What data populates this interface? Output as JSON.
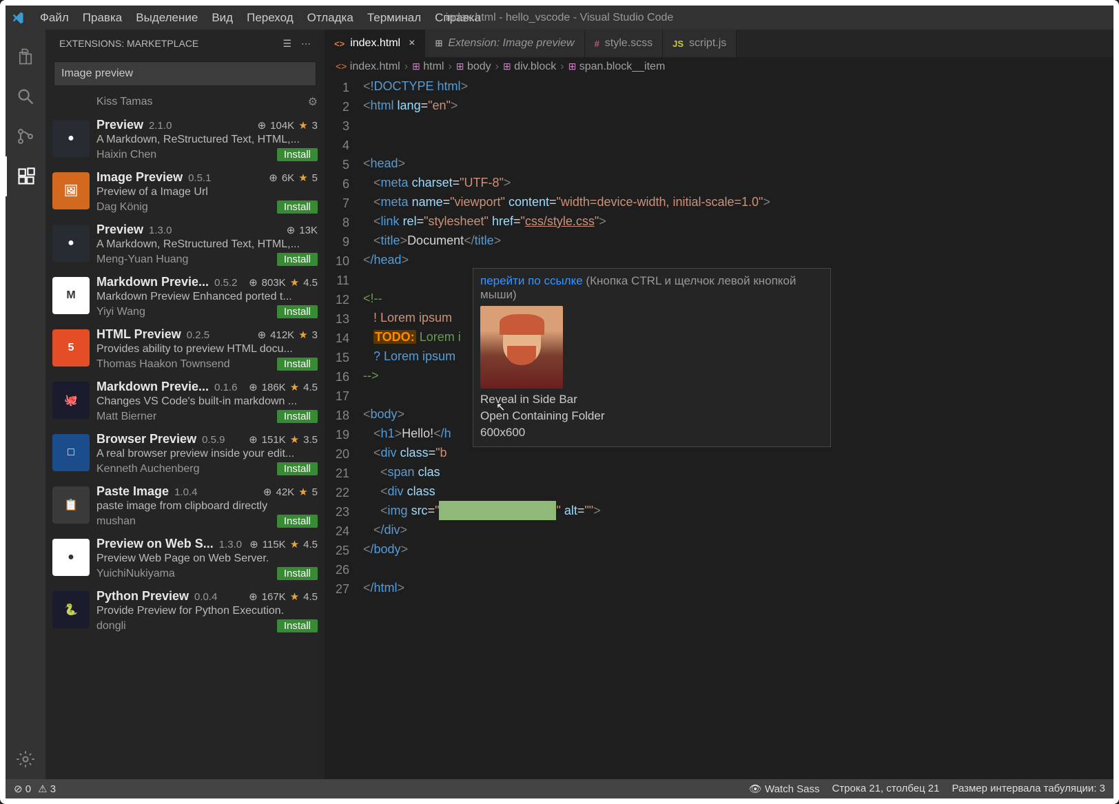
{
  "titlebar": {
    "menus": [
      "Файл",
      "Правка",
      "Выделение",
      "Вид",
      "Переход",
      "Отладка",
      "Терминал",
      "Справка"
    ],
    "title": "index.html - hello_vscode - Visual Studio Code"
  },
  "sidebar": {
    "header": "EXTENSIONS: MARKETPLACE",
    "search": "Image preview"
  },
  "extensions": [
    {
      "partial": true,
      "name": "",
      "version": "",
      "downloads": "",
      "rating": "",
      "desc": "",
      "author": "Kiss Tamas",
      "install": "",
      "iconBg": "",
      "iconText": ""
    },
    {
      "name": "Preview",
      "version": "2.1.0",
      "downloads": "104K",
      "rating": "3",
      "desc": "A Markdown, ReStructured Text, HTML,...",
      "author": "Haixin Chen",
      "install": "Install",
      "iconBg": "#272c33",
      "iconText": "●"
    },
    {
      "name": "Image Preview",
      "version": "0.5.1",
      "downloads": "6K",
      "rating": "5",
      "desc": "Preview of a Image Url",
      "author": "Dag König",
      "install": "Install",
      "iconBg": "#d2691e",
      "iconText": "🖼"
    },
    {
      "name": "Preview",
      "version": "1.3.0",
      "downloads": "13K",
      "rating": "",
      "desc": "A Markdown, ReStructured Text, HTML,...",
      "author": "Meng-Yuan Huang",
      "install": "Install",
      "iconBg": "#272c33",
      "iconText": "●"
    },
    {
      "name": "Markdown Previe...",
      "version": "0.5.2",
      "downloads": "803K",
      "rating": "4.5",
      "desc": "Markdown Preview Enhanced ported t...",
      "author": "Yiyi Wang",
      "install": "Install",
      "iconBg": "#fff",
      "iconText": "M"
    },
    {
      "name": "HTML Preview",
      "version": "0.2.5",
      "downloads": "412K",
      "rating": "3",
      "desc": "Provides ability to preview HTML docu...",
      "author": "Thomas Haakon Townsend",
      "install": "Install",
      "iconBg": "#e44d26",
      "iconText": "5"
    },
    {
      "name": "Markdown Previe...",
      "version": "0.1.6",
      "downloads": "186K",
      "rating": "4.5",
      "desc": "Changes VS Code's built-in markdown ...",
      "author": "Matt Bierner",
      "install": "Install",
      "iconBg": "#1b1b2e",
      "iconText": "🐙"
    },
    {
      "name": "Browser Preview",
      "version": "0.5.9",
      "downloads": "151K",
      "rating": "3.5",
      "desc": "A real browser preview inside your edit...",
      "author": "Kenneth Auchenberg",
      "install": "Install",
      "iconBg": "#1b4c8c",
      "iconText": "□"
    },
    {
      "name": "Paste Image",
      "version": "1.0.4",
      "downloads": "42K",
      "rating": "5",
      "desc": "paste image from clipboard directly",
      "author": "mushan",
      "install": "Install",
      "iconBg": "#3a3a3a",
      "iconText": "📋"
    },
    {
      "name": "Preview on Web S...",
      "version": "1.3.0",
      "downloads": "115K",
      "rating": "4.5",
      "desc": "Preview Web Page on Web Server.",
      "author": "YuichiNukiyama",
      "install": "Install",
      "iconBg": "#fff",
      "iconText": "●"
    },
    {
      "name": "Python Preview",
      "version": "0.0.4",
      "downloads": "167K",
      "rating": "4.5",
      "desc": "Provide Preview for Python Execution.",
      "author": "dongli",
      "install": "Install",
      "iconBg": "#1b1b2e",
      "iconText": "🐍"
    }
  ],
  "tabs": [
    {
      "label": "index.html",
      "icon": "<>",
      "iconColor": "#e37933",
      "active": true,
      "closable": true
    },
    {
      "label": "Extension: Image preview",
      "icon": "⊞",
      "iconColor": "#999",
      "active": false,
      "italic": true
    },
    {
      "label": "style.scss",
      "icon": "#",
      "iconColor": "#c6538c",
      "active": false
    },
    {
      "label": "script.js",
      "icon": "JS",
      "iconColor": "#cbcb41",
      "active": false
    }
  ],
  "breadcrumbs": [
    {
      "label": "index.html",
      "icon": "<>",
      "iconColor": "#e37933"
    },
    {
      "label": "html",
      "icon": "⊞",
      "iconColor": "#c586c0"
    },
    {
      "label": "body",
      "icon": "⊞",
      "iconColor": "#c586c0"
    },
    {
      "label": "div.block",
      "icon": "⊞",
      "iconColor": "#c586c0"
    },
    {
      "label": "span.block__item",
      "icon": "⊞",
      "iconColor": "#c586c0"
    }
  ],
  "code": {
    "lines": 27,
    "l1_doctype": "!DOCTYPE",
    "l1_html": "html",
    "l2_tag": "html",
    "l2_attr": "lang",
    "l2_val": "\"en\"",
    "l5_tag": "head",
    "l6_tag": "meta",
    "l6_attr": "charset",
    "l6_val": "\"UTF-8\"",
    "l7_tag": "meta",
    "l7_a1": "name",
    "l7_v1": "\"viewport\"",
    "l7_a2": "content",
    "l7_v2": "\"width=device-width, initial-scale=1.0\"",
    "l8_tag": "link",
    "l8_a1": "rel",
    "l8_v1": "\"stylesheet\"",
    "l8_a2": "href",
    "l8_v2": "\"css/style.css\"",
    "l9_tag": "title",
    "l9_text": "Document",
    "l10_tag": "/head",
    "l12_open": "<!--",
    "l13_text": "! Lorem ipsum",
    "l14_todo": "TODO:",
    "l14_text": " Lorem i",
    "l15_text": "? Lorem ipsum",
    "l16_close": "-->",
    "l18_tag": "body",
    "l19_tag": "h1",
    "l19_text": "Hello!",
    "l19_close": "/h",
    "l20_tag": "div",
    "l20_attr": "class",
    "l20_val": "\"b",
    "l21_tag": "span",
    "l21_attr": "clas",
    "l22_tag": "div",
    "l22_attr": "class",
    "l23_tag": "img",
    "l23_a1": "src",
    "l23_v1": "\"",
    "l23_a2": "alt",
    "l23_v2": "\"\"",
    "l24_tag": "/div",
    "l25_tag": "/body",
    "l27_tag": "/html"
  },
  "hover": {
    "link": "перейти по ссылке",
    "hint": "(Кнопка CTRL и щелчок левой кнопкой мыши)",
    "reveal": "Reveal in Side Bar",
    "open": "Open Containing Folder",
    "dims": "600x600"
  },
  "status": {
    "errors": "0",
    "warnings": "3",
    "watch": "Watch Sass",
    "cursor": "Строка 21, столбец 21",
    "tabsize": "Размер интервала табуляции: 3"
  },
  "colors": {
    "accent": "#007acc",
    "install": "#388a34",
    "star": "#e8a33d"
  }
}
